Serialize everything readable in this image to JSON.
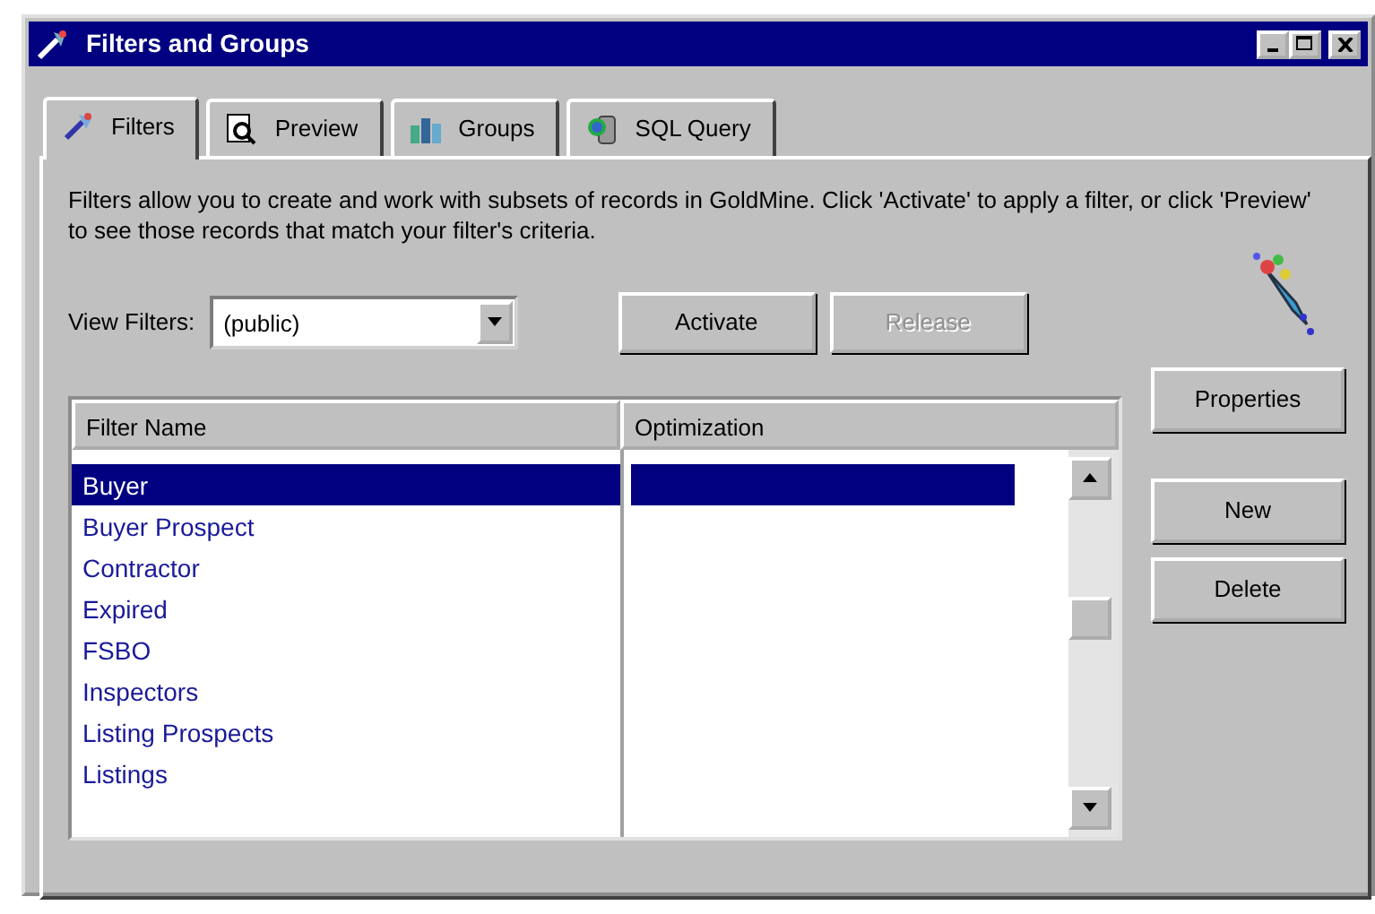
{
  "window": {
    "title": "Filters and Groups"
  },
  "tabs": [
    {
      "label": "Filters",
      "selected": true,
      "kind": "wand"
    },
    {
      "label": "Preview",
      "selected": false,
      "kind": "preview"
    },
    {
      "label": "Groups",
      "selected": false,
      "kind": "groups"
    },
    {
      "label": "SQL Query",
      "selected": false,
      "kind": "sql"
    }
  ],
  "description": "Filters allow you to create and work with subsets of records in GoldMine.  Click 'Activate' to apply a filter, or click 'Preview' to see those records that match your filter's criteria.",
  "view_filters": {
    "label": "View Filters:",
    "value": "(public)"
  },
  "action_buttons": [
    {
      "label": "Activate",
      "disabled": false
    },
    {
      "label": "Release",
      "disabled": true
    }
  ],
  "table": {
    "columns": [
      "Filter Name",
      "Optimization"
    ],
    "rows": [
      {
        "name": "Buyer",
        "selected": true
      },
      {
        "name": "Buyer Prospect",
        "selected": false
      },
      {
        "name": "Contractor",
        "selected": false
      },
      {
        "name": "Expired",
        "selected": false
      },
      {
        "name": "FSBO",
        "selected": false
      },
      {
        "name": "Inspectors",
        "selected": false
      },
      {
        "name": "Listing Prospects",
        "selected": false
      },
      {
        "name": "Listings",
        "selected": false
      }
    ]
  },
  "side_buttons": [
    {
      "label": "Properties"
    },
    {
      "label": "New"
    },
    {
      "label": "Delete"
    }
  ]
}
